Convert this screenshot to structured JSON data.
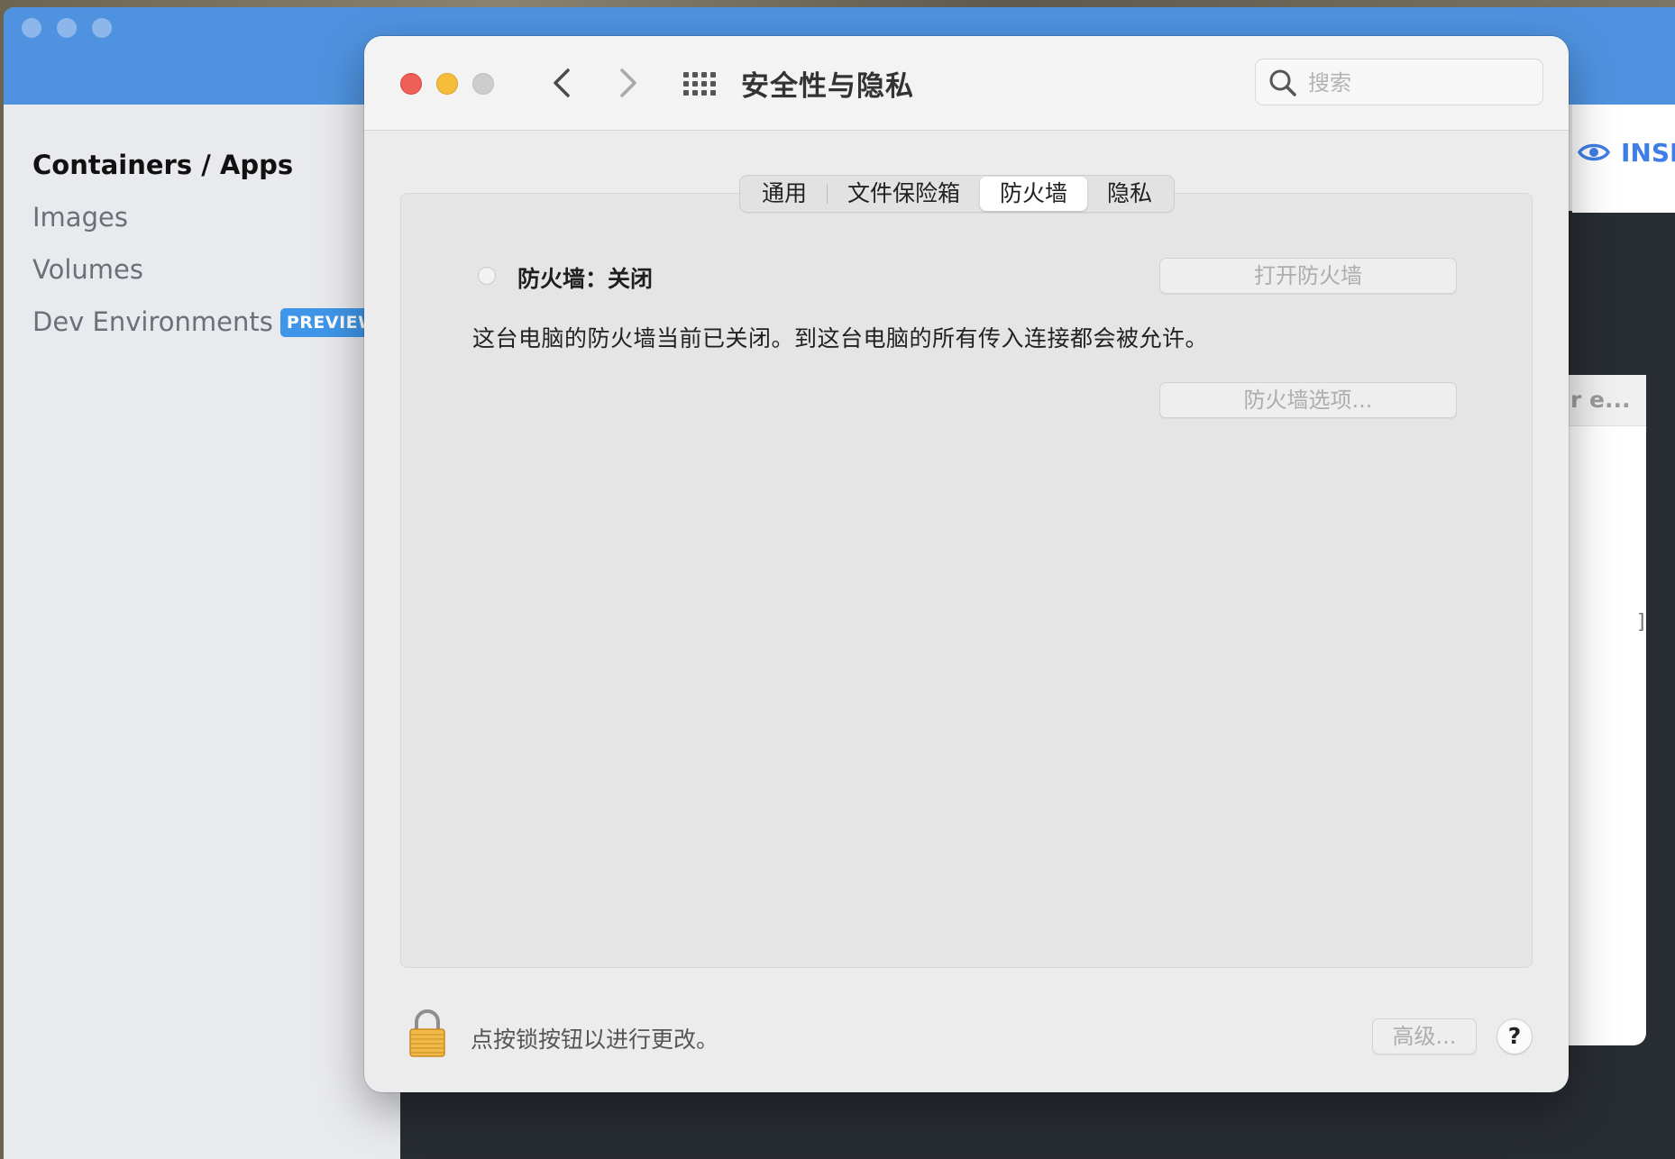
{
  "background_app": {
    "sidebar": {
      "items": [
        {
          "label": "Containers / Apps",
          "active": true
        },
        {
          "label": "Images"
        },
        {
          "label": "Volumes"
        },
        {
          "label": "Dev Environments",
          "badge": "PREVIEW"
        }
      ]
    },
    "inspect_label": "INSP",
    "card_header_fragment": "r e..."
  },
  "prefs": {
    "title": "安全性与隐私",
    "search": {
      "placeholder": "搜索",
      "value": ""
    },
    "tabs": [
      {
        "label": "通用"
      },
      {
        "label": "文件保险箱"
      },
      {
        "label": "防火墙",
        "selected": true
      },
      {
        "label": "隐私"
      }
    ],
    "firewall": {
      "status_label": "防火墙：关闭",
      "turn_on_button": "打开防火墙",
      "description": "这台电脑的防火墙当前已关闭。到这台电脑的所有传入连接都会被允许。",
      "options_button": "防火墙选项..."
    },
    "footer": {
      "lock_text": "点按锁按钮以进行更改。",
      "advanced_button": "高级...",
      "help_button": "?"
    }
  }
}
